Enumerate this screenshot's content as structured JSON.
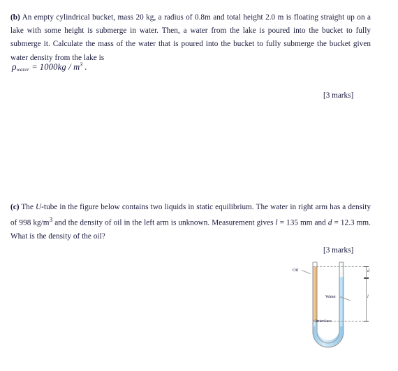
{
  "document": {
    "question_b": {
      "label": "(b)",
      "text": "An empty cylindrical bucket, mass 20 kg, a radius of 0.8m and total height 2.0 m is floating straight up on a lake with some height is submerge in water. Then, a water from the lake is poured into the bucket to fully submerge it. Calculate the mass of the water that is poured into the bucket to fully submerge the bucket given water density from the lake is",
      "formula": {
        "symbol": "ρ",
        "subscript": "water",
        "equals": "=",
        "value": "1000",
        "unit": "kg / m",
        "exponent": "3",
        "trailing": "."
      },
      "marks": "[3 marks]"
    },
    "question_c": {
      "label": "(c)",
      "text_part1": "The ",
      "italic_U": "U",
      "text_part2": "-tube in the figure below contains two liquids in static equilibrium. The water in right arm has a density of 998 kg/m",
      "sup_3": "3",
      "text_part3": " and the density of oil in the left arm is unknown. Measurement gives ",
      "italic_l": "l",
      "text_part4": " = 135 mm and ",
      "italic_d": "d",
      "text_part5": " = 12.3 mm. What is the density of the oil?",
      "marks": "[3 marks]"
    },
    "figure": {
      "name": "u-tube-manometer",
      "labels": {
        "oil": "Oil",
        "water": "Water",
        "interface": "Interface",
        "dimension_d": "d",
        "dimension_l": "l"
      },
      "colors": {
        "oil": "#f0b265",
        "water": "#a8d4ee",
        "tube_outline": "#9aa0a6",
        "dashed_guide": "#8d8d8d"
      }
    }
  }
}
